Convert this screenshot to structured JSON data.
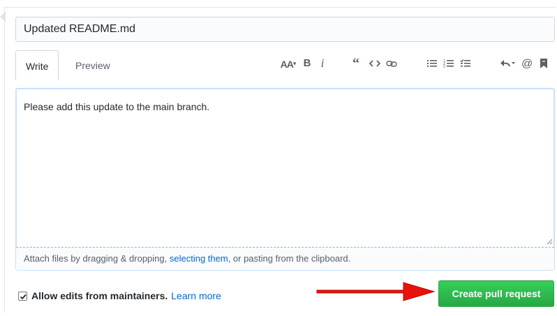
{
  "pr_form": {
    "title_value": "Updated README.md",
    "tabs": [
      {
        "label": "Write"
      },
      {
        "label": "Preview"
      }
    ],
    "toolbar": {
      "header": "AA",
      "bold": "B",
      "italic": "i",
      "icons": [
        "header-icon",
        "bold-icon",
        "italic-icon",
        "quote-icon",
        "code-icon",
        "link-icon",
        "bulleted-list-icon",
        "numbered-list-icon",
        "task-list-icon",
        "reply-icon",
        "mention-icon",
        "saved-reply-icon"
      ]
    },
    "body_text": "Please add this update to the main branch.",
    "attach": {
      "prefix": "Attach files by dragging & dropping, ",
      "link": "selecting them",
      "suffix": ", or pasting from the clipboard."
    },
    "allow_edits": {
      "checked": true,
      "label": "Allow edits from maintainers.",
      "learn_more": "Learn more"
    },
    "submit_label": "Create pull request"
  },
  "colors": {
    "primary_button": "#2ea44f",
    "link": "#0366d6",
    "annotation_arrow": "#e8120c"
  }
}
